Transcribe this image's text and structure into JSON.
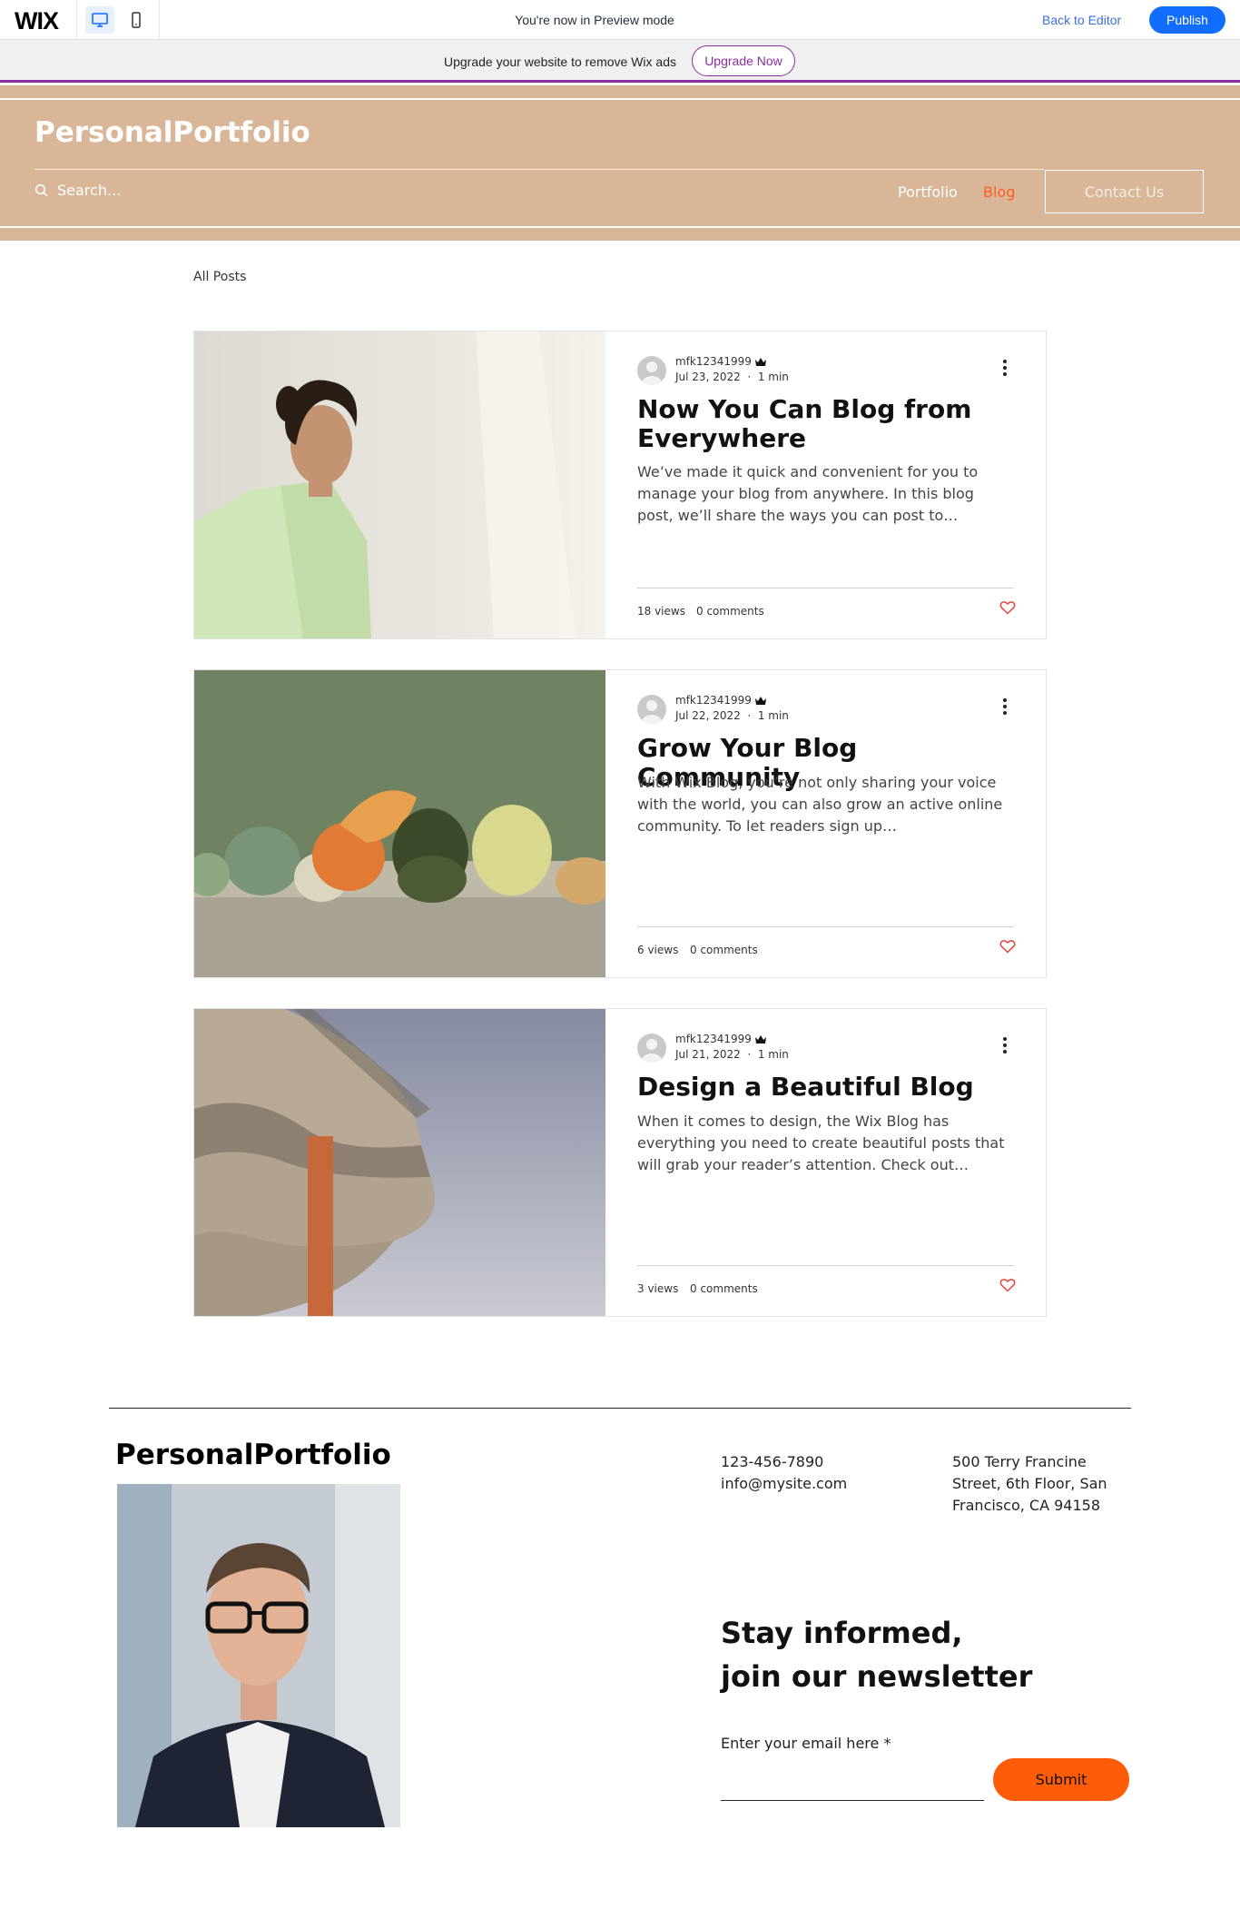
{
  "wix_bar": {
    "logo": "WIX",
    "device_desktop_icon": "desktop-icon",
    "device_mobile_icon": "mobile-icon",
    "preview_text": "You're now in Preview mode",
    "back_to_editor": "Back to Editor",
    "publish": "Publish",
    "accent": "#116dff"
  },
  "upgrade_banner": {
    "text": "Upgrade your website to remove Wix ads",
    "button": "Upgrade Now",
    "accent": "#8a2ea0"
  },
  "header": {
    "site_title": "PersonalPortfolio",
    "search_placeholder": "Search...",
    "nav": {
      "portfolio": "Portfolio",
      "blog": "Blog",
      "contact": "Contact Us"
    },
    "background": "#d9b698",
    "active_color": "#ff5c21"
  },
  "blog": {
    "all_posts": "All Posts",
    "posts": [
      {
        "author": "mfk12341999",
        "date": "Jul 23, 2022",
        "read_time": "1 min",
        "title": "Now You Can Blog from Everywhere",
        "excerpt": "We’ve made it quick and convenient for you to manage your blog from anywhere. In this blog post, we’ll share the ways you can post to…",
        "views": "18 views",
        "comments": "0 comments",
        "image": "woman-portrait-image"
      },
      {
        "author": "mfk12341999",
        "date": "Jul 22, 2022",
        "read_time": "1 min",
        "title": "Grow Your Blog Community",
        "excerpt": "With Wix Blog, you’re not only sharing your voice with the world, you can also grow an active online community. To let readers sign up…",
        "views": "6 views",
        "comments": "0 comments",
        "image": "vegetables-still-life-image"
      },
      {
        "author": "mfk12341999",
        "date": "Jul 21, 2022",
        "read_time": "1 min",
        "title": "Design a Beautiful Blog",
        "excerpt": "When it comes to design, the Wix Blog has everything you need to create beautiful posts that will grab your reader’s attention. Check out…",
        "views": "3 views",
        "comments": "0 comments",
        "image": "curved-building-image"
      }
    ]
  },
  "footer": {
    "brand": "PersonalPortfolio",
    "phone": "123-456-7890",
    "email": "info@mysite.com",
    "address": "500 Terry Francine Street, 6th Floor, San Francisco, CA 94158",
    "newsletter_title_1": "Stay informed,",
    "newsletter_title_2": "join our newsletter",
    "email_label": "Enter your email here *",
    "submit": "Submit",
    "submit_color": "#ff5c0a"
  }
}
